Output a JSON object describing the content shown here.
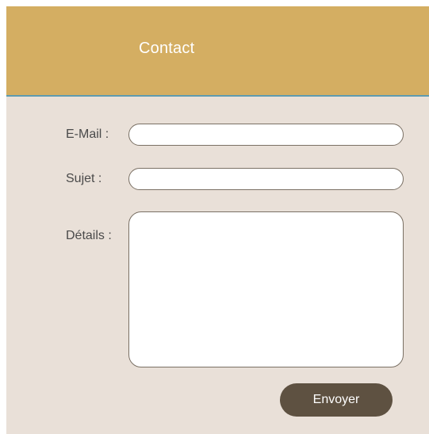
{
  "header": {
    "title": "Contact"
  },
  "form": {
    "email": {
      "label": "E-Mail :",
      "value": "",
      "placeholder": ""
    },
    "subject": {
      "label": "Sujet :",
      "value": "",
      "placeholder": ""
    },
    "details": {
      "label": "Détails :",
      "value": "",
      "placeholder": ""
    },
    "submit_label": "Envoyer"
  },
  "colors": {
    "header_bg": "#d4ae62",
    "header_border": "#5d9bb0",
    "panel_bg": "#e9e0d8",
    "button_bg": "#5e5141",
    "label_text": "#4a4a4a"
  }
}
